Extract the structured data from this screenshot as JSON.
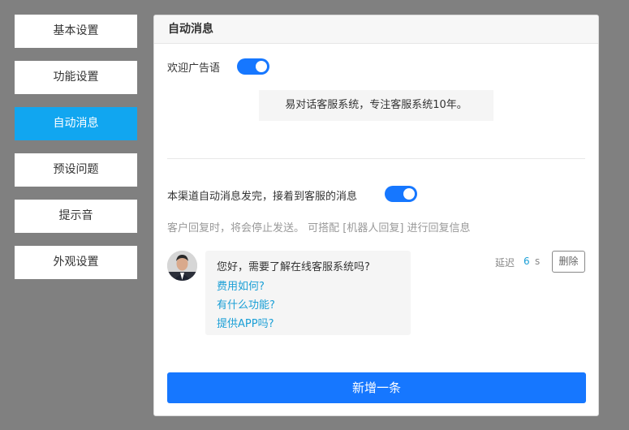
{
  "sidebar": {
    "items": [
      {
        "label": "基本设置",
        "active": false
      },
      {
        "label": "功能设置",
        "active": false
      },
      {
        "label": "自动消息",
        "active": true
      },
      {
        "label": "预设问题",
        "active": false
      },
      {
        "label": "提示音",
        "active": false
      },
      {
        "label": "外观设置",
        "active": false
      }
    ]
  },
  "panel": {
    "title": "自动消息",
    "welcome": {
      "label": "欢迎广告语",
      "enabled": true,
      "text": "易对话客服系统，专注客服系统10年。"
    },
    "channel": {
      "label": "本渠道自动消息发完，接着到客服的消息",
      "enabled": true,
      "hint": "客户回复时，将会停止发送。 可搭配 [机器人回复] 进行回复信息"
    },
    "message": {
      "question": "您好，需要了解在线客服系统吗?",
      "links": [
        "费用如何?",
        "有什么功能?",
        "提供APP吗?"
      ],
      "delay_label": "延迟",
      "delay_value": "6",
      "delay_unit": "s",
      "delete_label": "删除"
    },
    "add_label": "新增一条"
  },
  "colors": {
    "accent": "#1677ff",
    "active_tab": "#11a6f0",
    "link": "#1a9fd6",
    "backdrop": "#808080"
  }
}
